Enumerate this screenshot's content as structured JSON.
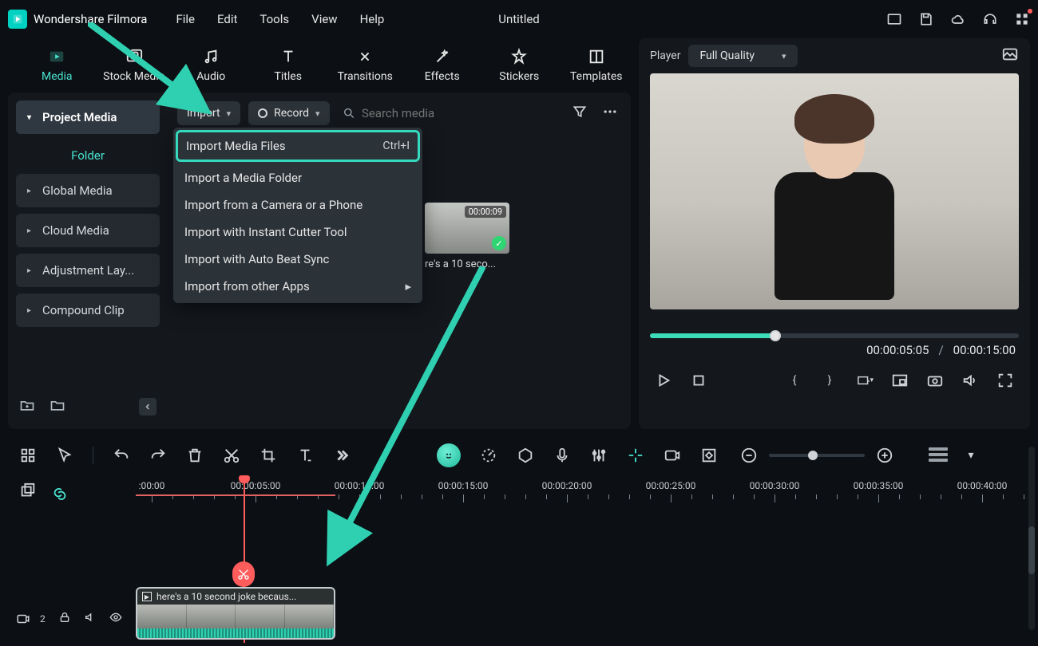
{
  "app": {
    "name": "Wondershare Filmora",
    "document": "Untitled"
  },
  "menu": [
    "File",
    "Edit",
    "Tools",
    "View",
    "Help"
  ],
  "media_tabs": [
    {
      "id": "media",
      "label": "Media"
    },
    {
      "id": "stock",
      "label": "Stock Media"
    },
    {
      "id": "audio",
      "label": "Audio"
    },
    {
      "id": "titles",
      "label": "Titles"
    },
    {
      "id": "transitions",
      "label": "Transitions"
    },
    {
      "id": "effects",
      "label": "Effects"
    },
    {
      "id": "stickers",
      "label": "Stickers"
    },
    {
      "id": "templates",
      "label": "Templates"
    }
  ],
  "sidebar": {
    "project_media": "Project Media",
    "folder": "Folder",
    "items": [
      "Global Media",
      "Cloud Media",
      "Adjustment Lay...",
      "Compound Clip"
    ]
  },
  "toolbar": {
    "import_label": "Import",
    "record_label": "Record",
    "search_placeholder": "Search media"
  },
  "import_menu": [
    {
      "label": "Import Media Files",
      "shortcut": "Ctrl+I",
      "highlight": true
    },
    {
      "label": "Import a Media Folder"
    },
    {
      "label": "Import from a Camera or a Phone"
    },
    {
      "label": "Import with Instant Cutter Tool"
    },
    {
      "label": "Import with Auto Beat Sync"
    },
    {
      "label": "Import from other Apps",
      "submenu": true
    }
  ],
  "thumb": {
    "duration": "00:00:09",
    "name": "re's a 10 seco..."
  },
  "player": {
    "tab": "Player",
    "quality": "Full Quality",
    "current": "00:00:05:05",
    "sep": "/",
    "total": "00:00:15:00"
  },
  "ruler": [
    ":00:00",
    "00:00:05:00",
    "00:00:10:00",
    "00:00:15:00",
    "00:00:20:00",
    "00:00:25:00",
    "00:00:30:00",
    "00:00:35:00",
    "00:00:40:00"
  ],
  "track": {
    "video_index": "2"
  },
  "clip": {
    "title": "here's a 10 second joke becaus..."
  }
}
